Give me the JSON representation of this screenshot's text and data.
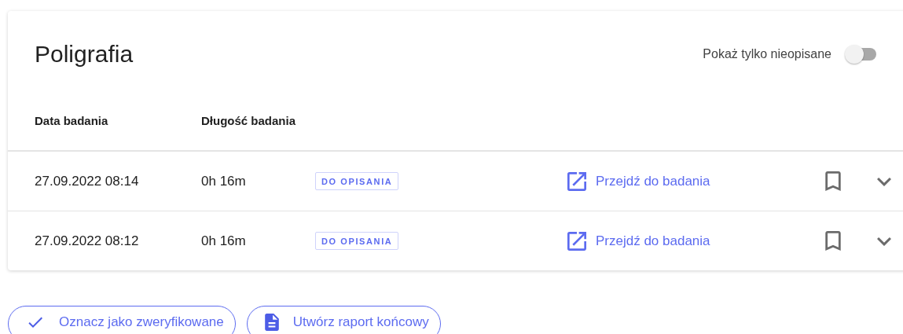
{
  "title": "Poligrafia",
  "filter_toggle": {
    "label": "Pokaż tylko nieopisane",
    "on": false
  },
  "table": {
    "columns": [
      "Data badania",
      "Długość badania"
    ],
    "rows": [
      {
        "date": "27.09.2022 08:14",
        "duration": "0h 16m",
        "status": "DO OPISANIA",
        "link": "Przejdź do badania",
        "bookmarked": false,
        "expanded": false
      },
      {
        "date": "27.09.2022 08:12",
        "duration": "0h 16m",
        "status": "DO OPISANIA",
        "link": "Przejdź do badania",
        "bookmarked": false,
        "expanded": false
      }
    ]
  },
  "actions": [
    {
      "kind": "verify",
      "label": "Oznacz jako zweryfikowane"
    },
    {
      "kind": "report",
      "label": "Utwórz raport końcowy"
    }
  ]
}
